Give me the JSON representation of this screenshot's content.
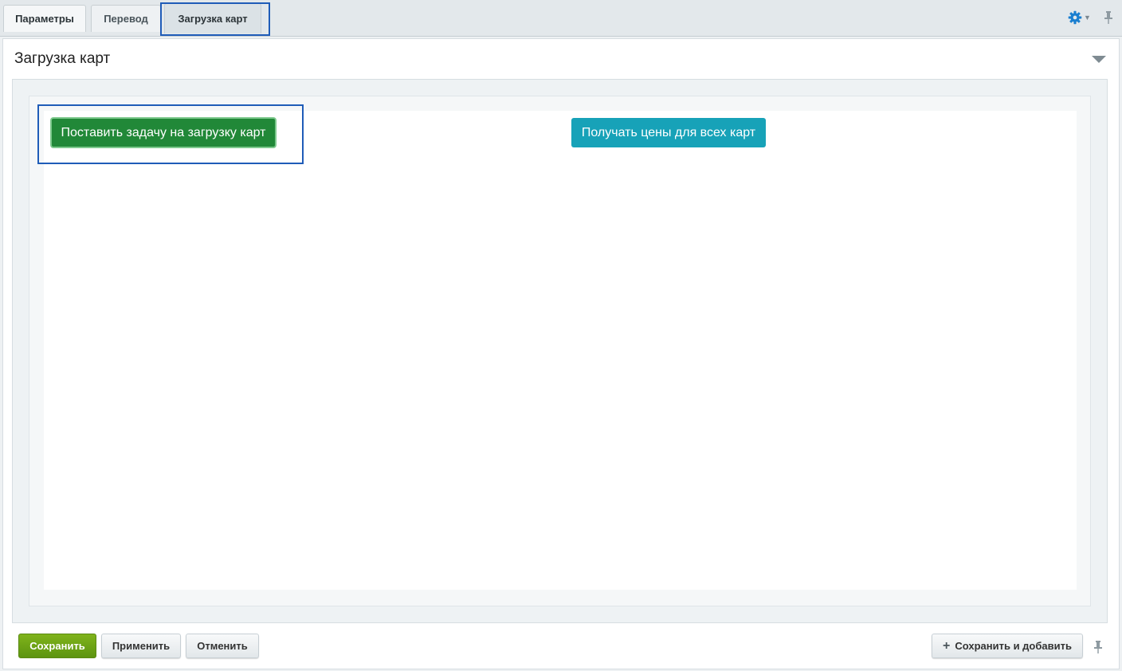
{
  "tabs": [
    {
      "label": "Параметры"
    },
    {
      "label": "Перевод"
    },
    {
      "label": "Загрузка карт"
    }
  ],
  "section": {
    "title": "Загрузка карт"
  },
  "actions": {
    "queue_button": "Поставить задачу на загрузку карт",
    "prices_button": "Получать цены для всех карт"
  },
  "footer": {
    "save": "Сохранить",
    "apply": "Применить",
    "cancel": "Отменить",
    "save_and_add": "Сохранить и добавить"
  },
  "icons": {
    "gear": "gear-icon",
    "pin": "pin-icon",
    "collapse": "chevron-down-icon",
    "plus": "plus-icon"
  },
  "colors": {
    "green_button": "#218838",
    "cyan_button": "#17a2b8",
    "save_button": "#6aa116",
    "highlight": "#1f5cb8",
    "gear": "#1a7fd0"
  }
}
